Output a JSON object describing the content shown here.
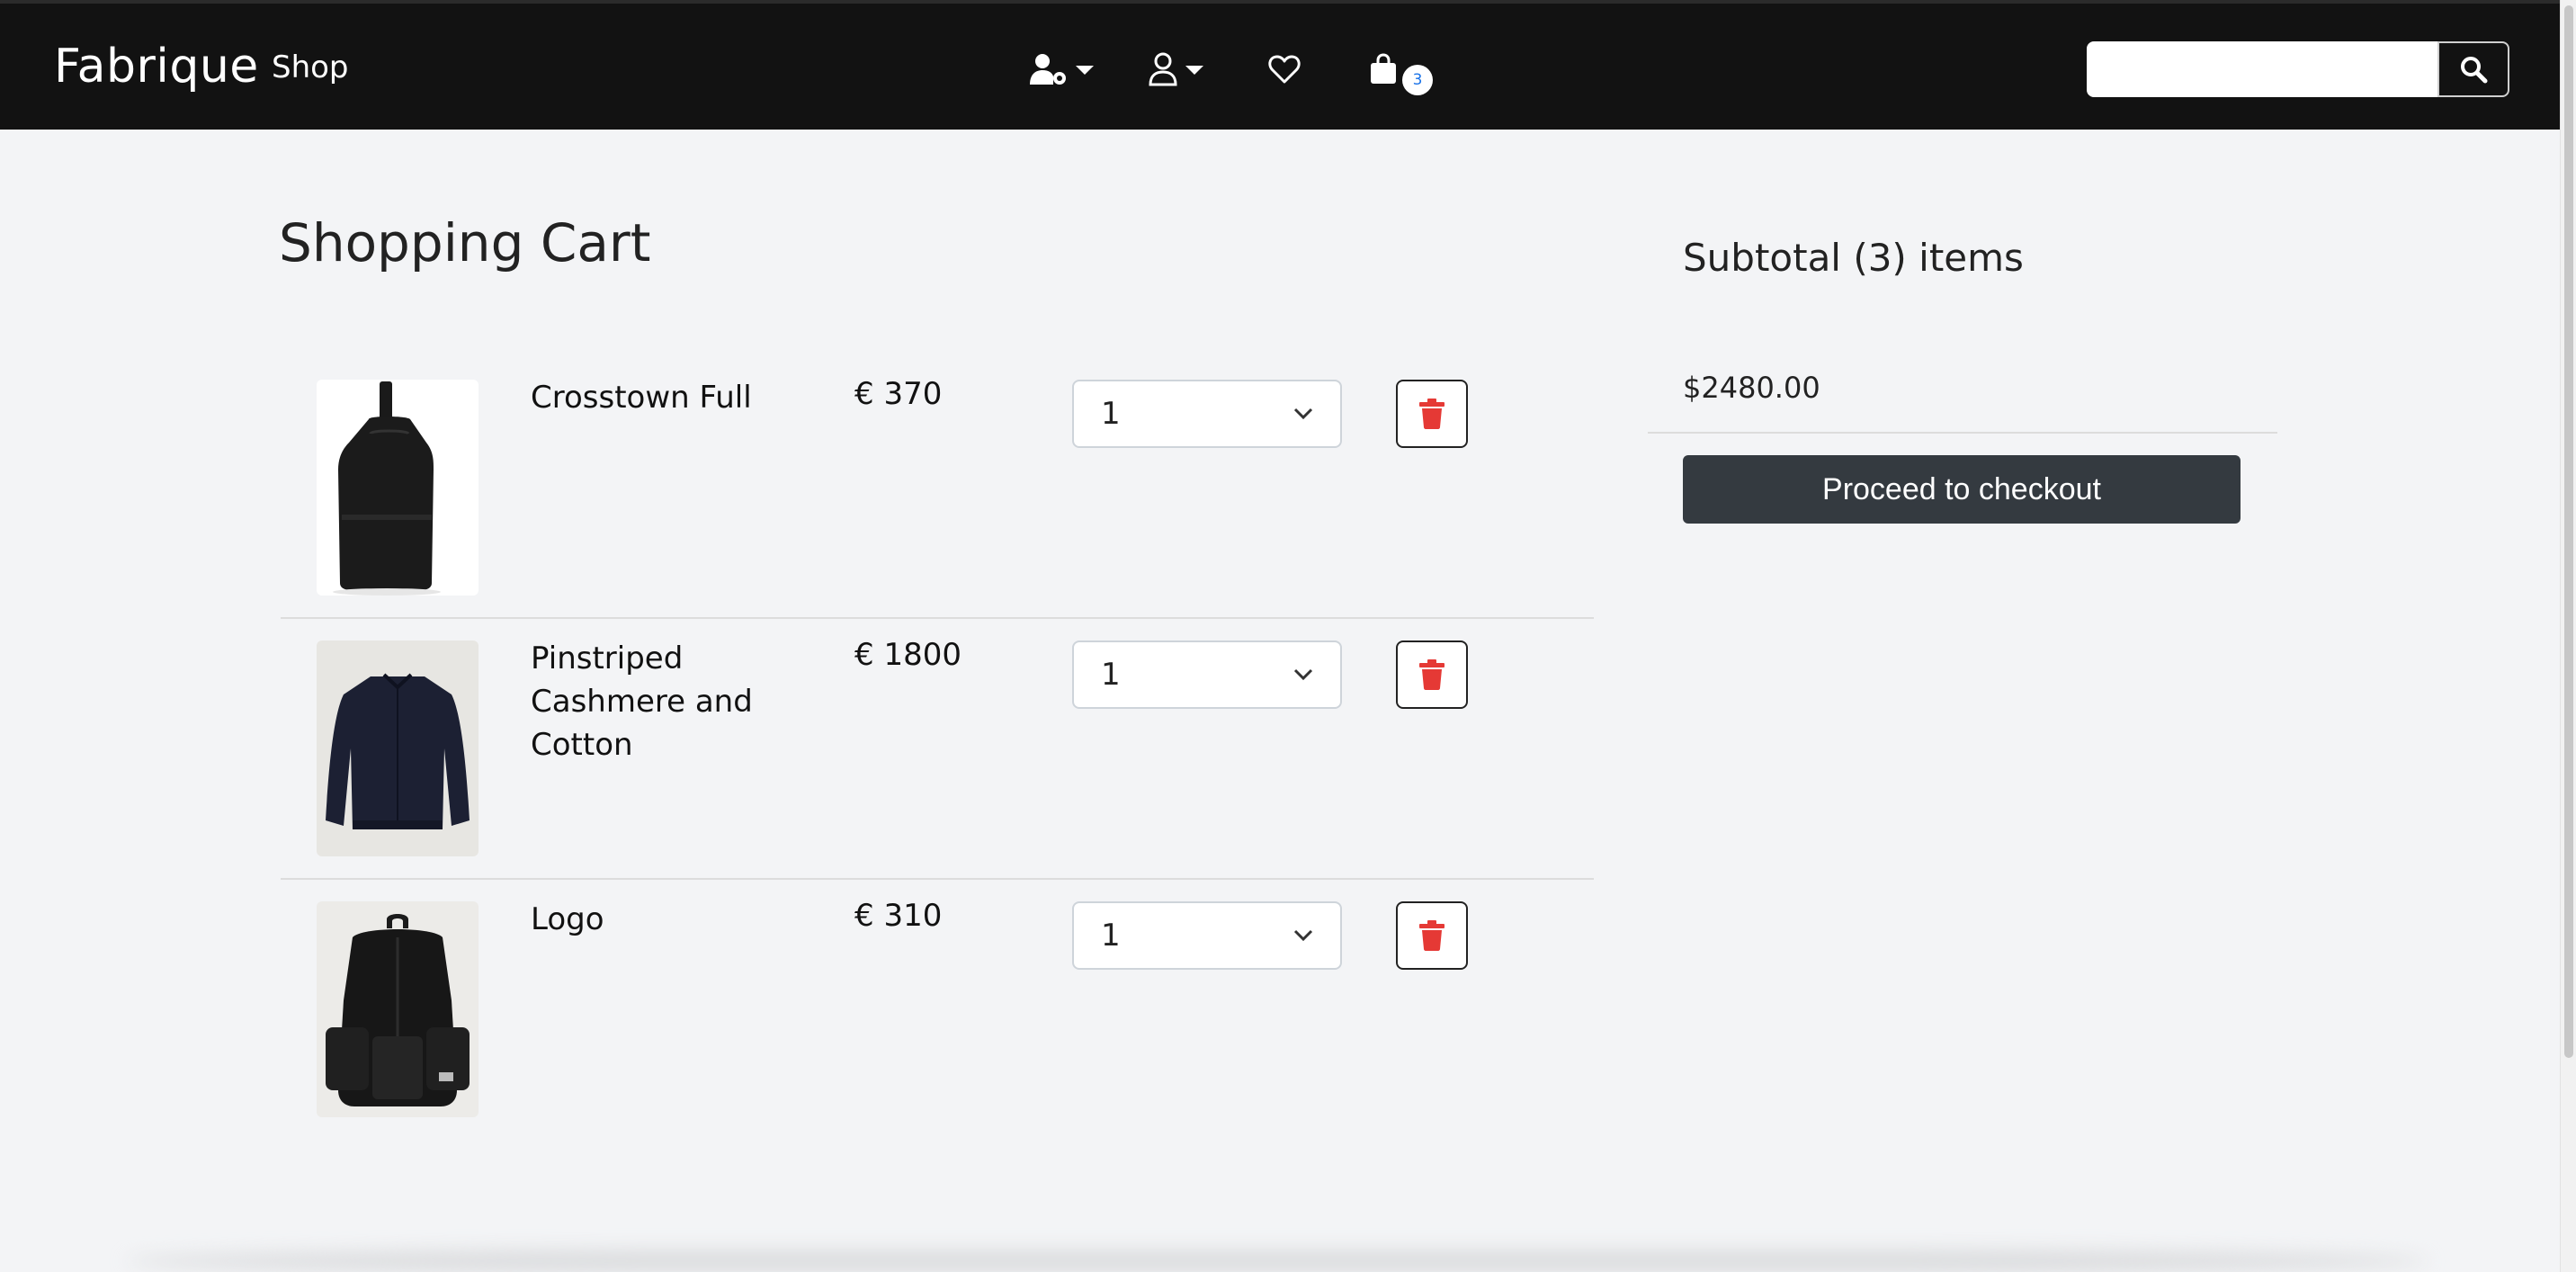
{
  "navbar": {
    "brand": "Fabrique",
    "shop_link": "Shop",
    "icons": [
      "admin-user-gear-icon",
      "user-icon",
      "heart-icon",
      "shopping-bag-icon"
    ],
    "cart_count": "3",
    "search": {
      "placeholder": "",
      "value": ""
    }
  },
  "cart": {
    "title": "Shopping Cart",
    "items": [
      {
        "name": "Crosstown Full",
        "price": "€ 370",
        "quantity": "1"
      },
      {
        "name": "Pinstriped Cashmere and Cotton",
        "price": "€ 1800",
        "quantity": "1"
      },
      {
        "name": "Logo",
        "price": "€ 310",
        "quantity": "1"
      }
    ]
  },
  "summary": {
    "subtotal_title": "Subtotal (3) items",
    "subtotal_amount": "$2480.00",
    "checkout_label": "Proceed to checkout"
  },
  "colors": {
    "navbar_bg": "#121212",
    "page_bg": "#f3f4f6",
    "checkout_bg": "#343a40",
    "delete_icon": "#e53935",
    "badge_text": "#1a73e8"
  }
}
